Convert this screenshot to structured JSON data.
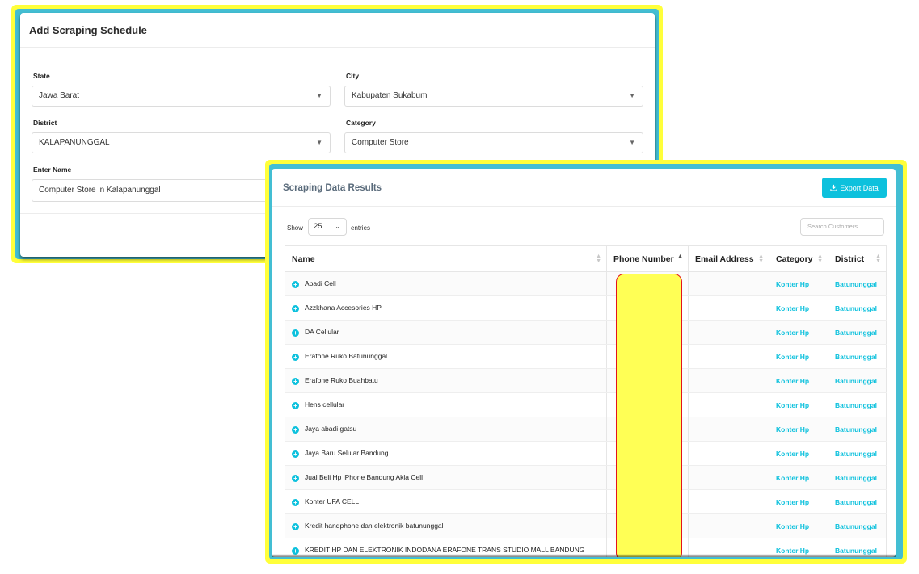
{
  "schedule": {
    "title": "Add Scraping Schedule",
    "state_label": "State",
    "state_value": "Jawa Barat",
    "city_label": "City",
    "city_value": "Kabupaten Sukabumi",
    "district_label": "District",
    "district_value": "KALAPANUNGGAL",
    "category_label": "Category",
    "category_value": "Computer Store",
    "name_label": "Enter Name",
    "name_value": "Computer Store in Kalapanunggal"
  },
  "results": {
    "title": "Scraping Data Results",
    "export_label": "Export Data",
    "show_label": "Show",
    "page_length": "25",
    "entries_label": "entries",
    "search_placeholder": "Search Customers...",
    "columns": [
      "Name",
      "Phone Number",
      "Email Address",
      "Category",
      "District"
    ],
    "rows": [
      {
        "name": "Abadi Cell",
        "phone": "",
        "email": "",
        "category": "Konter Hp",
        "district": "Batununggal"
      },
      {
        "name": "Azzkhana Accesories HP",
        "phone": "",
        "email": "",
        "category": "Konter Hp",
        "district": "Batununggal"
      },
      {
        "name": "DA Cellular",
        "phone": "",
        "email": "",
        "category": "Konter Hp",
        "district": "Batununggal"
      },
      {
        "name": "Erafone Ruko Batununggal",
        "phone": "",
        "email": "",
        "category": "Konter Hp",
        "district": "Batununggal"
      },
      {
        "name": "Erafone Ruko Buahbatu",
        "phone": "",
        "email": "",
        "category": "Konter Hp",
        "district": "Batununggal"
      },
      {
        "name": "Hens cellular",
        "phone": "",
        "email": "",
        "category": "Konter Hp",
        "district": "Batununggal"
      },
      {
        "name": "Jaya abadi gatsu",
        "phone": "",
        "email": "",
        "category": "Konter Hp",
        "district": "Batununggal"
      },
      {
        "name": "Jaya Baru Selular Bandung",
        "phone": "",
        "email": "",
        "category": "Konter Hp",
        "district": "Batununggal"
      },
      {
        "name": "Jual Beli Hp iPhone Bandung Akla Cell",
        "phone": "",
        "email": "",
        "category": "Konter Hp",
        "district": "Batununggal"
      },
      {
        "name": "Konter UFA CELL",
        "phone": "",
        "email": "",
        "category": "Konter Hp",
        "district": "Batununggal"
      },
      {
        "name": "Kredit handphone dan elektronik batununggal",
        "phone": "",
        "email": "",
        "category": "Konter Hp",
        "district": "Batununggal"
      },
      {
        "name": "KREDIT HP DAN ELEKTRONIK INDODANA ERAFONE TRANS STUDIO MALL BANDUNG",
        "phone": "",
        "email": "",
        "category": "Konter Hp",
        "district": "Batununggal"
      }
    ]
  },
  "icons": {
    "select_chevron": "chevron-down-icon",
    "expand": "plus-circle-icon",
    "export": "download-icon",
    "sort": "sort-icon"
  },
  "colors": {
    "highlight_frame": "#ffff3a",
    "accent": "#0dc1dd",
    "redaction_fill": "#ffff55",
    "redaction_border": "#e3141a"
  }
}
